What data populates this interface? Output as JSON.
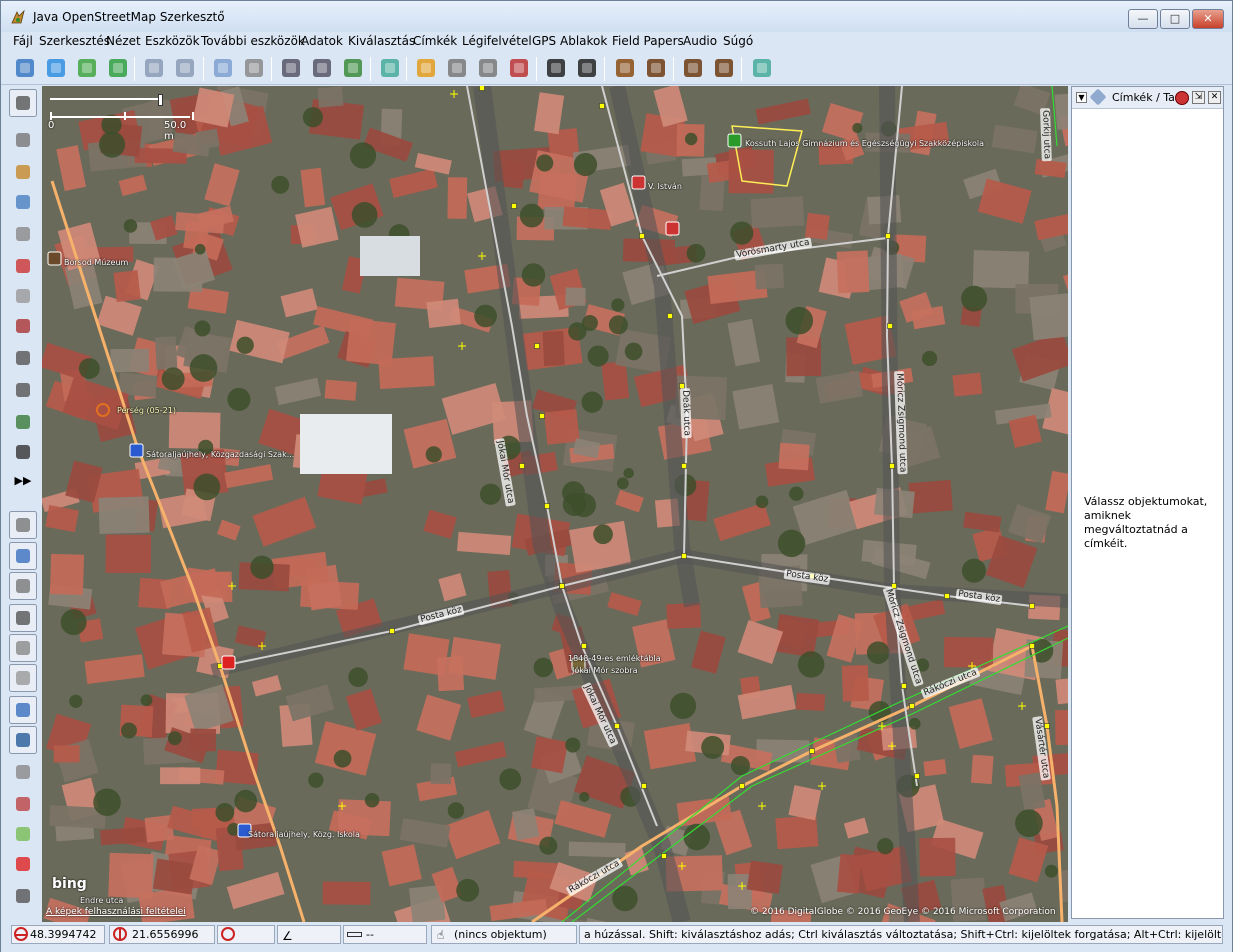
{
  "window": {
    "title": "Java OpenStreetMap Szerkesztő",
    "minimize_label": "—",
    "maximize_label": "□",
    "close_label": "✕"
  },
  "menu": [
    "Fájl",
    "Szerkesztés",
    "Nézet",
    "Eszközök",
    "További eszközök",
    "Adatok",
    "Kiválasztás",
    "Címkék",
    "Légifelvétel",
    "GPS",
    "Ablakok",
    "Field Papers",
    "Audio",
    "Súgó"
  ],
  "toolbar": {
    "icons": [
      "open-file-icon",
      "download-icon",
      "download-data-icon",
      "upload-icon",
      "undo-icon",
      "redo-icon",
      "zoom-to-selection-icon",
      "preferences-icon",
      "split-way-icon",
      "combine-way-icon",
      "update-data-icon",
      "zoom-fit-icon",
      "traffic-signals-icon",
      "railway-icon",
      "barrier-icon",
      "wall-icon",
      "car-icon",
      "bus-icon",
      "danger-icon",
      "restaurant-icon",
      "castle-icon",
      "industrial-icon",
      "add-node-icon"
    ]
  },
  "left_toolbar": {
    "icons": [
      "select-icon",
      "lasso-icon",
      "draw-icon",
      "zoom-icon",
      "delete-icon",
      "improve-way-icon",
      "parallel-icon",
      "extrude-icon",
      "add-node-on-way-icon",
      "gpx-icon",
      "map-paint-icon",
      "grid-icon",
      "more-icon",
      "layers-icon",
      "tags-icon",
      "relation-icon",
      "selection-list-icon",
      "conflict-icon",
      "history-icon",
      "minimize-icon",
      "validate-icon",
      "filter-icon",
      "plugin-box-icon",
      "map-style-icon",
      "pin-icon",
      "measure-icon"
    ],
    "more_label": "▶▶"
  },
  "map": {
    "scale_zero": "0",
    "scale_label": "50.0 m",
    "attribution": "© 2016 DigitalGlobe © 2016 GeoEye © 2016 Microsoft Corporation",
    "bing_terms": "A képek felhasználási feltételei",
    "bing_logo": "bing",
    "labels": {
      "museum": "Borsod Múzeum",
      "school_top": "Kossuth Lajos Gimnázium és Egészségügyi Szakközépiskola",
      "v_istvan": "V. István",
      "vorosmarty": "Vörösmarty utca",
      "perseg": "Perség (05-21)",
      "satoraljaujhely_kozgaz": "Sátoraljaújhely, Közgazdasági Szak...",
      "jokai_utca": "Jókai Mór utca",
      "deak_utca": "Deák utca",
      "moricz_utca": "Móricz Zsigmond utca",
      "posta_koz_1": "Posta köz",
      "posta_koz_2": "Posta köz",
      "posta_koz_3": "Posta köz",
      "emlektabla": "1848-49-es emléktábla",
      "jokai_szoba": "Jókai Mór szobra",
      "jokai_mor_utca_2": "Jókai Mór utca",
      "moricz_utca_2": "Móricz Zsigmond utca",
      "rakoczi_1": "Rákóczi utca",
      "rakoczi_2": "Rákóczi utca",
      "vasarter": "Vásártér utca",
      "satoraljaujhely_kozg_iskola": "Sátoraljaújhely, Közg. Iskola",
      "endre_utca": "Endre utca",
      "gorkij_utca": "Gorkij utca"
    }
  },
  "side_panel": {
    "title": "Címkék / Tagok",
    "message": "Válassz objektumokat, amiknek megváltoztatnád a címkéit."
  },
  "status": {
    "lat": "48.3994742",
    "lon": "21.6556996",
    "heading": "",
    "angle": "",
    "distance": "--",
    "selection": "(nincs objektum)",
    "help": "a húzással. Shift: kiválasztáshoz adás; Ctrl kiválasztás változtatása; Shift+Ctrl: kijelöltek forgatása; Alt+Ctrl: kijelöltek átméretezése"
  },
  "colors": {
    "road_major": "#f6b26b",
    "footway": "#d0d0d0",
    "railway_green": "#33dd33",
    "node_yellow": "#ffff00"
  }
}
